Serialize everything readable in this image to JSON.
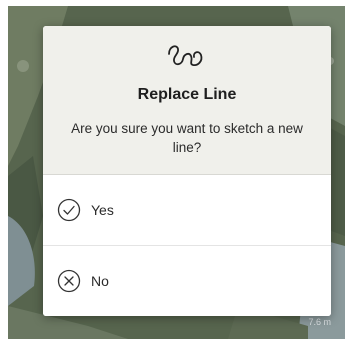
{
  "map": {
    "scale_text": "7.6 m"
  },
  "dialog": {
    "icon": "sketch-squiggle-icon",
    "title": "Replace Line",
    "message": "Are you sure you want to sketch a new line?",
    "options": [
      {
        "label": "Yes",
        "icon": "check-circle-icon"
      },
      {
        "label": "No",
        "icon": "x-circle-icon"
      }
    ]
  }
}
